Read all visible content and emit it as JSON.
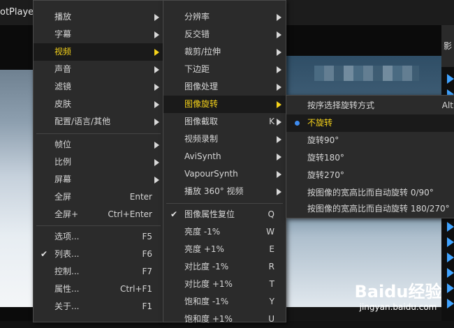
{
  "app": {
    "title": "otPlayer"
  },
  "menu_main": {
    "items": [
      {
        "label": "播放",
        "submenu": true
      },
      {
        "label": "字幕",
        "submenu": true
      },
      {
        "label": "视频",
        "submenu": true,
        "highlighted": true
      },
      {
        "label": "声音",
        "submenu": true
      },
      {
        "label": "滤镜",
        "submenu": true
      },
      {
        "label": "皮肤",
        "submenu": true
      },
      {
        "label": "配置/语言/其他",
        "submenu": true
      },
      {
        "label": "帧位",
        "submenu": true
      },
      {
        "label": "比例",
        "submenu": true
      },
      {
        "label": "屏幕",
        "submenu": true
      },
      {
        "label": "全屏",
        "shortcut": "Enter"
      },
      {
        "label": "全屏+",
        "shortcut": "Ctrl+Enter"
      },
      {
        "label": "选项...",
        "shortcut": "F5"
      },
      {
        "label": "列表...",
        "shortcut": "F6",
        "checked": true
      },
      {
        "label": "控制...",
        "shortcut": "F7"
      },
      {
        "label": "属性...",
        "shortcut": "Ctrl+F1"
      },
      {
        "label": "关于...",
        "shortcut": "F1"
      }
    ]
  },
  "menu_video": {
    "items": [
      {
        "label": "分辨率",
        "submenu": true
      },
      {
        "label": "反交错",
        "submenu": true
      },
      {
        "label": "裁剪/拉伸",
        "submenu": true
      },
      {
        "label": "下边距",
        "submenu": true
      },
      {
        "label": "图像处理",
        "submenu": true
      },
      {
        "label": "图像旋转",
        "submenu": true,
        "highlighted": true
      },
      {
        "label": "图像截取",
        "shortcut": "K"
      },
      {
        "label": "视频录制",
        "submenu": true
      },
      {
        "label": "AviSynth",
        "submenu": true
      },
      {
        "label": "VapourSynth",
        "submenu": true
      },
      {
        "label": "播放 360° 视频",
        "submenu": true
      },
      {
        "label": "图像属性复位",
        "shortcut": "Q",
        "checked": true
      },
      {
        "label": "亮度 -1%",
        "shortcut": "W"
      },
      {
        "label": "亮度 +1%",
        "shortcut": "E"
      },
      {
        "label": "对比度 -1%",
        "shortcut": "R"
      },
      {
        "label": "对比度 +1%",
        "shortcut": "T"
      },
      {
        "label": "饱和度 -1%",
        "shortcut": "Y"
      },
      {
        "label": "饱和度 +1%",
        "shortcut": "U"
      }
    ]
  },
  "menu_rotate": {
    "items": [
      {
        "label": "按序选择旋转方式",
        "shortcut": "Alt"
      },
      {
        "label": "不旋转",
        "selected": true,
        "highlighted": true
      },
      {
        "label": "旋转90°"
      },
      {
        "label": "旋转180°"
      },
      {
        "label": "旋转270°"
      },
      {
        "label": "按图像的宽高比而自动旋转 0/90°"
      },
      {
        "label": "按图像的宽高比而自动旋转 180/270°"
      }
    ]
  },
  "playlist": {
    "header": "影"
  },
  "watermark": {
    "logo": "Baidu经验",
    "url": "jingyan.baidu.com"
  },
  "colors": {
    "highlight_text": "#f5d21a",
    "menu_bg": "#2b2b2b",
    "radio_dot": "#3e8cf0",
    "playlist_arrow": "#3fa3ff"
  }
}
